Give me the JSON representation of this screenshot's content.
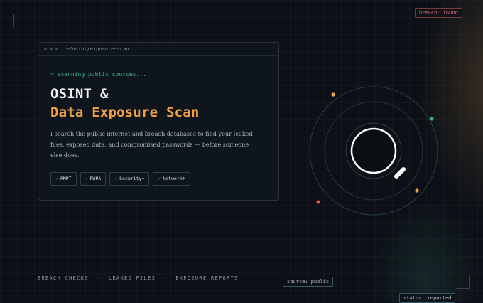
{
  "terminal": {
    "path": "~/osint/exposure-scan",
    "prompt": "> scanning public sources...",
    "title_line1": "OSINT &",
    "title_line2": "Data Exposure Scan",
    "description": "I search the public internet and breach databases to find your leaked files, exposed data, and compromised passwords — before someone else does.",
    "badges": [
      {
        "check": "✓",
        "label": "PNPT"
      },
      {
        "check": "✓",
        "label": "PWPA"
      },
      {
        "check": "✓",
        "label": "Security+"
      },
      {
        "check": "✓",
        "label": "Network+"
      }
    ]
  },
  "tags": {
    "breach": "breach: found",
    "source": "source: public",
    "status": "status: reported"
  },
  "footer": {
    "links": [
      "BREACH CHECKS",
      "LEAKED FILES",
      "EXPOSURE REPORTS"
    ],
    "separator": "·"
  },
  "colors": {
    "accent_orange": "#f0a044",
    "accent_green": "#3fb08f",
    "alert_red": "#e06a6a",
    "background": "#0d1117"
  },
  "icons": {
    "magnifier": "magnifying-glass-icon",
    "radar": "radar-rings"
  }
}
